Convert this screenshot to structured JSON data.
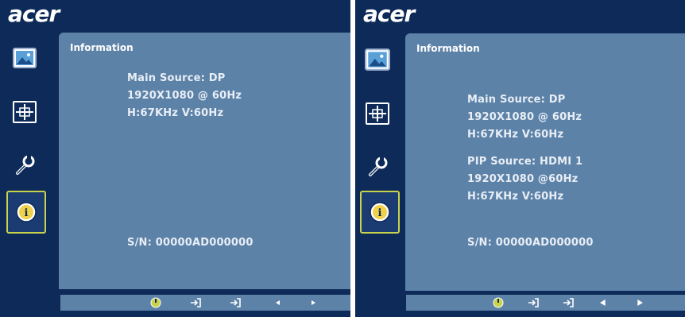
{
  "screens": [
    {
      "logo": "acer",
      "panel_title": "Information",
      "lines": [
        "Main Source: DP",
        "1920X1080 @ 60Hz",
        "H:67KHz   V:60Hz"
      ],
      "serial": "S/N:  00000AD000000",
      "sidebar_icons": [
        "picture-icon",
        "display-position-icon",
        "setup-wrench-icon",
        "information-icon"
      ],
      "active_icon": "information-icon"
    },
    {
      "logo": "acer",
      "panel_title": "Information",
      "lines": [
        "Main Source: DP",
        "1920X1080 @ 60Hz",
        "H:67KHz   V:60Hz",
        "PIP Source: HDMI 1",
        "1920X1080 @60Hz",
        "H:67KHz   V:60Hz"
      ],
      "serial": "S/N:  00000AD000000",
      "sidebar_icons": [
        "picture-icon",
        "display-position-icon",
        "setup-wrench-icon",
        "information-icon"
      ],
      "active_icon": "information-icon"
    }
  ],
  "bottom_bar_icons": [
    "power-icon",
    "input-enter-icon",
    "exit-icon",
    "left-arrow-icon",
    "right-arrow-icon"
  ],
  "colors": {
    "background": "#0d2a58",
    "panel": "#5d82a8",
    "active_border": "#c8d24a",
    "text": "#ffffff"
  }
}
